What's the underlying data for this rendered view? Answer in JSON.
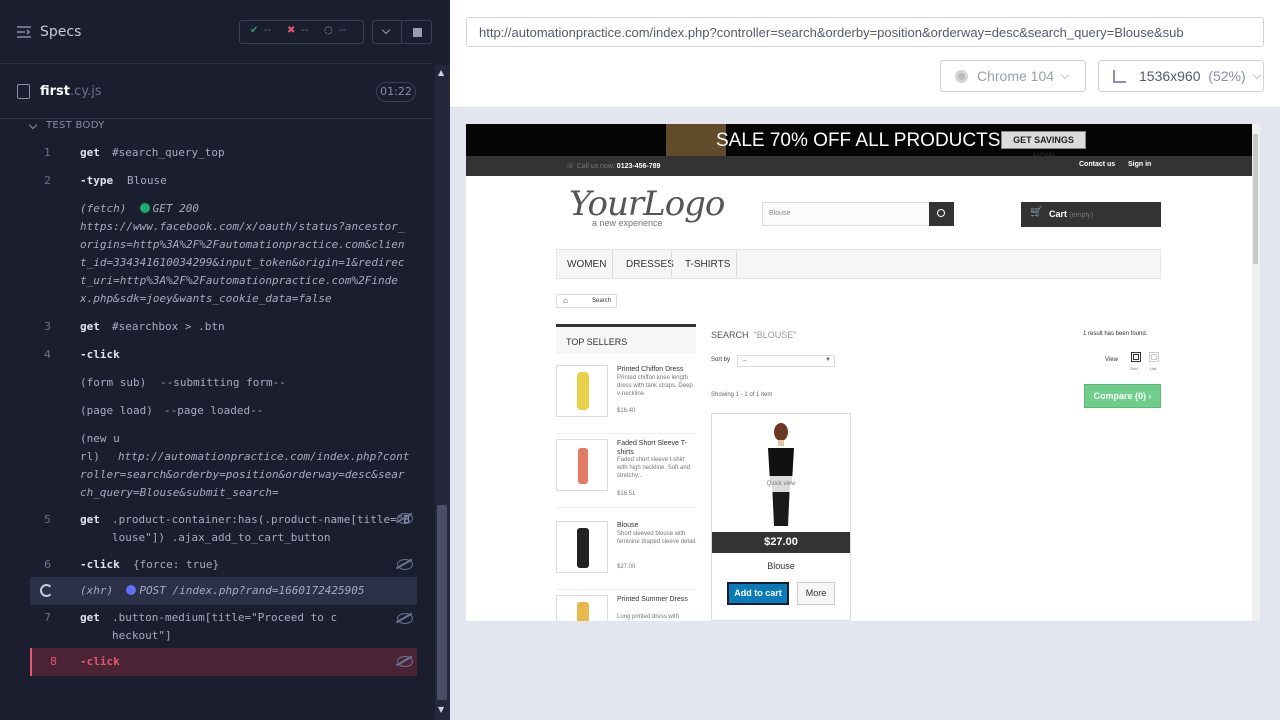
{
  "reporter": {
    "title": "Specs",
    "stats": {
      "passed": "--",
      "failed": "--",
      "pending": "--"
    },
    "file": {
      "name": "first",
      "ext": ".cy.js",
      "duration": "01:22"
    },
    "section": "TEST BODY",
    "commands": [
      {
        "num": "1",
        "name": "get",
        "msg": "#search_query_top"
      },
      {
        "num": "2",
        "name": "-type",
        "msg": "Blouse"
      },
      {
        "num": "",
        "name": "(fetch)",
        "msg": "GET 200",
        "msg2": "https://www.facebook.com/x/oauth/status?ancestor_origins=http%3A%2F%2Fautomationpractice.com&client_id=334341610034299&input_token&origin=1&redirect_uri=http%3A%2F%2Fautomationpractice.com%2Findex.php&sdk=joey&wants_cookie_data=false"
      },
      {
        "num": "3",
        "name": "get",
        "msg": "#searchbox > .btn"
      },
      {
        "num": "4",
        "name": "-click",
        "msg": ""
      },
      {
        "num": "",
        "name": "(form sub)",
        "msg": "--submitting form--"
      },
      {
        "num": "",
        "name": "(page load)",
        "msg": "--page loaded--"
      },
      {
        "num": "",
        "name": "(new url)",
        "msg": "http://automationpractice.com/index.php?controller=search&orderby=position&orderway=desc&search_query=Blouse&submit_search="
      },
      {
        "num": "5",
        "name": "get",
        "msg": ".product-container:has(.product-name[title=\"Blouse\"]) .ajax_add_to_cart_button"
      },
      {
        "num": "6",
        "name": "-click",
        "msg": "{force: true}"
      },
      {
        "num": "",
        "name": "(xhr)",
        "msg": "POST /index.php?rand=1660172425905"
      },
      {
        "num": "7",
        "name": "get",
        "msg": ".button-medium[title=\"Proceed to checkout\"]"
      },
      {
        "num": "8",
        "name": "-click",
        "msg": ""
      }
    ]
  },
  "browser": {
    "url": "http://automationpractice.com/index.php?controller=search&orderby=position&orderway=desc&search_query=Blouse&sub",
    "name": "Chrome 104",
    "viewport": "1536x960",
    "scale": "(52%)"
  },
  "site": {
    "banner": "SALE 70% OFF ALL PRODUCTS",
    "banner_btn": "GET SAVINGS NOW",
    "phone_label": "Call us now:",
    "phone": "0123-456-789",
    "contact": "Contact us",
    "signin": "Sign in",
    "logo": "YourLogo",
    "logo_sub": "a new experience",
    "search_value": "Blouse",
    "cart": "Cart",
    "cart_state": "(empty)",
    "menu": [
      "WOMEN",
      "DRESSES",
      "T-SHIRTS"
    ],
    "crumb": "Search",
    "top_sellers_title": "TOP SELLERS",
    "top_sellers": [
      {
        "name": "Printed Chiffon Dress",
        "desc": "Printed chiffon knee length dress with tank straps. Deep v-neckline.",
        "price": "$16.40"
      },
      {
        "name": "Faded Short Sleeve T-shirts",
        "desc": "Faded short sleeve t-shirt with high neckline. Soft and stretchy...",
        "price": "$16.51"
      },
      {
        "name": "Blouse",
        "desc": "Short sleeved blouse with feminine draped sleeve detail.",
        "price": "$27.00"
      },
      {
        "name": "Printed Summer Dress",
        "desc": "Long printed dress with",
        "price": ""
      }
    ],
    "search_heading": "SEARCH",
    "search_term": "\"BLOUSE\"",
    "results_found": "1 result has been found.",
    "sort_by": "Sort by",
    "sort_value": "--",
    "view": "View",
    "grid": "Grid",
    "list": "List",
    "showing": "Showing 1 - 1 of 1 item",
    "compare": "Compare (0)",
    "product": {
      "price": "$27.00",
      "name": "Blouse",
      "quick_view": "Quick view",
      "add_to_cart": "Add to cart",
      "more": "More"
    }
  }
}
